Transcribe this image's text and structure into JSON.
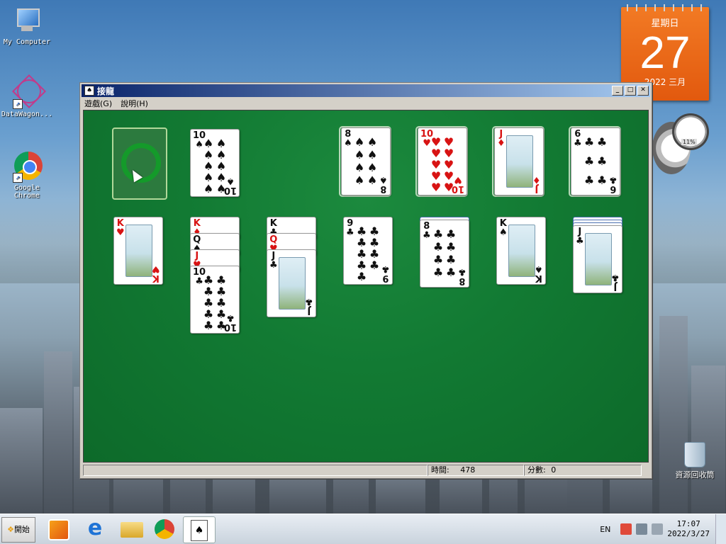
{
  "desktop": {
    "icons": [
      {
        "label": "My Computer"
      },
      {
        "label": "DataWagon..."
      },
      {
        "label": "Google Chrome"
      }
    ],
    "recycle_bin": {
      "label": "資源回收筒"
    }
  },
  "calendar_gadget": {
    "weekday": "星期日",
    "day": "27",
    "year_month": "2022 三月"
  },
  "cpu_meter": {
    "percent": "11%"
  },
  "window": {
    "title": "接龍",
    "menu": [
      "遊戲(G)",
      "說明(H)"
    ],
    "controls": {
      "minimize": "_",
      "maximize": "□",
      "close": "✕"
    },
    "status": {
      "time_label": "時間:",
      "time_value": "478",
      "score_label": "分數:",
      "score_value": "0"
    }
  },
  "game": {
    "waste_top": {
      "rank": "10",
      "suit": "♠",
      "color": "black"
    },
    "foundations": [
      {
        "rank": "8",
        "suit": "♠",
        "color": "black"
      },
      {
        "rank": "10",
        "suit": "♥",
        "color": "red"
      },
      {
        "rank": "J",
        "suit": "♦",
        "color": "red"
      },
      {
        "rank": "6",
        "suit": "♣",
        "color": "black"
      }
    ],
    "tableau": [
      {
        "hidden": 0,
        "cards": [
          {
            "rank": "K",
            "suit": "♥",
            "color": "red"
          }
        ]
      },
      {
        "hidden": 0,
        "cards": [
          {
            "rank": "K",
            "suit": "♦",
            "color": "red"
          },
          {
            "rank": "Q",
            "suit": "♠",
            "color": "black"
          },
          {
            "rank": "J",
            "suit": "♥",
            "color": "red"
          },
          {
            "rank": "10",
            "suit": "♣",
            "color": "black"
          }
        ]
      },
      {
        "hidden": 0,
        "cards": [
          {
            "rank": "K",
            "suit": "♣",
            "color": "black"
          },
          {
            "rank": "Q",
            "suit": "♥",
            "color": "red"
          },
          {
            "rank": "J",
            "suit": "♣",
            "color": "black"
          }
        ]
      },
      {
        "hidden": 0,
        "cards": [
          {
            "rank": "9",
            "suit": "♣",
            "color": "black"
          }
        ]
      },
      {
        "hidden": 1,
        "cards": [
          {
            "rank": "8",
            "suit": "♣",
            "color": "black"
          }
        ]
      },
      {
        "hidden": 0,
        "cards": [
          {
            "rank": "K",
            "suit": "♠",
            "color": "black"
          }
        ]
      },
      {
        "hidden": 3,
        "cards": [
          {
            "rank": "J",
            "suit": "♣",
            "color": "black"
          }
        ]
      }
    ]
  },
  "taskbar": {
    "start_label": "開始",
    "apps": [
      "media-player",
      "internet-explorer",
      "file-explorer",
      "chrome",
      "solitaire"
    ],
    "language": "EN",
    "time": "17:07",
    "date": "2022/3/27"
  }
}
